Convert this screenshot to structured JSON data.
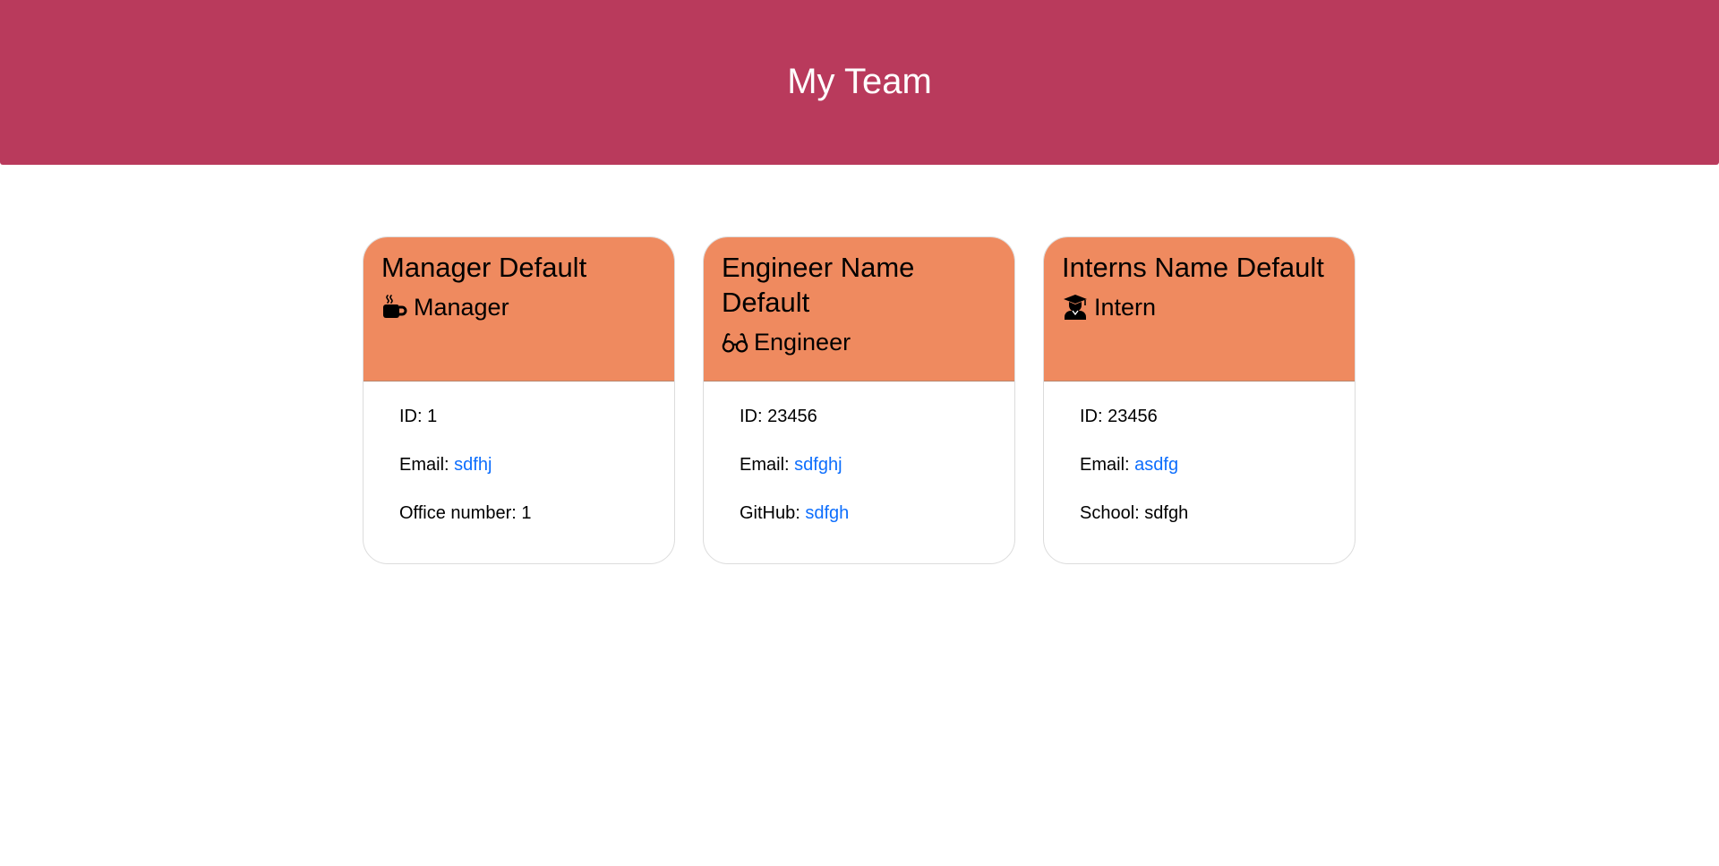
{
  "header": {
    "title": "My Team"
  },
  "colors": {
    "banner": "#b93a5c",
    "card_header": "#ef8a5f",
    "link": "#0d6efd"
  },
  "cards": [
    {
      "name": "Manager Default",
      "role": "Manager",
      "role_icon": "mug-icon",
      "id_label": "ID:",
      "id_value": "1",
      "email_label": "Email:",
      "email_value": "sdfhj",
      "extra_label": "Office number:",
      "extra_value": "1"
    },
    {
      "name": "Engineer Name Default",
      "role": "Engineer",
      "role_icon": "glasses-icon",
      "id_label": "ID:",
      "id_value": "23456",
      "email_label": "Email:",
      "email_value": "sdfghj",
      "extra_label": "GitHub:",
      "extra_value": "sdfgh"
    },
    {
      "name": "Interns Name Default",
      "role": "Intern",
      "role_icon": "graduate-icon",
      "id_label": "ID:",
      "id_value": "23456",
      "email_label": "Email:",
      "email_value": "asdfg",
      "extra_label": "School:",
      "extra_value": "sdfgh"
    }
  ]
}
